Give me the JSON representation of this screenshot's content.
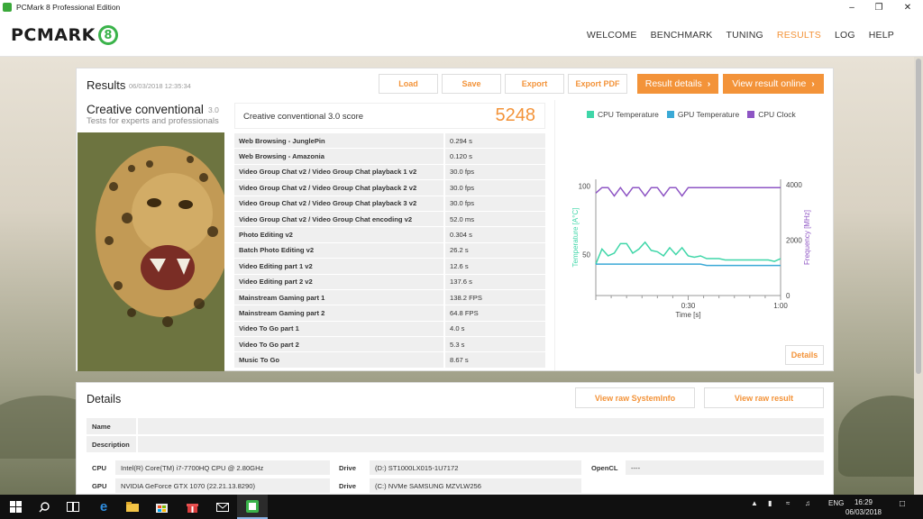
{
  "window": {
    "title": "PCMark 8 Professional Edition"
  },
  "header": {
    "logo_text": "PCMARK",
    "logo_mark": "8",
    "nav": [
      "WELCOME",
      "BENCHMARK",
      "TUNING",
      "RESULTS",
      "LOG",
      "HELP"
    ],
    "active_nav": "RESULTS"
  },
  "results": {
    "title": "Results",
    "date": "06/03/2018 12:35:34",
    "buttons": {
      "load": "Load",
      "save": "Save",
      "export": "Export",
      "export_pdf": "Export PDF",
      "result_details": "Result details",
      "view_online": "View result online"
    },
    "test_name": "Creative conventional",
    "test_version": "3.0",
    "test_subtitle": "Tests for experts and professionals",
    "score_label": "Creative conventional 3.0 score",
    "score_value": "5248",
    "rows": [
      {
        "name": "Web Browsing - JunglePin",
        "value": "0.294 s"
      },
      {
        "name": "Web Browsing - Amazonia",
        "value": "0.120 s"
      },
      {
        "name": "Video Group Chat v2 / Video Group Chat playback 1 v2",
        "value": "30.0 fps"
      },
      {
        "name": "Video Group Chat v2 / Video Group Chat playback 2 v2",
        "value": "30.0 fps"
      },
      {
        "name": "Video Group Chat v2 / Video Group Chat playback 3 v2",
        "value": "30.0 fps"
      },
      {
        "name": "Video Group Chat v2 / Video Group Chat encoding v2",
        "value": "52.0 ms"
      },
      {
        "name": "Photo Editing v2",
        "value": "0.304 s"
      },
      {
        "name": "Batch Photo Editing v2",
        "value": "26.2 s"
      },
      {
        "name": "Video Editing part 1 v2",
        "value": "12.6 s"
      },
      {
        "name": "Video Editing part 2 v2",
        "value": "137.6 s"
      },
      {
        "name": "Mainstream Gaming part 1",
        "value": "138.2 FPS"
      },
      {
        "name": "Mainstream Gaming part 2",
        "value": "64.8 FPS"
      },
      {
        "name": "Video To Go part 1",
        "value": "4.0 s"
      },
      {
        "name": "Video To Go part 2",
        "value": "5.3 s"
      },
      {
        "name": "Music To Go",
        "value": "8.67 s"
      }
    ],
    "details_button": "Details"
  },
  "chart_data": {
    "type": "line",
    "legend": [
      "CPU Temperature",
      "GPU Temperature",
      "CPU Clock"
    ],
    "colors": {
      "cpu_temp": "#3fd6a8",
      "gpu_temp": "#3aa9d6",
      "cpu_clock": "#8e55c4"
    },
    "x": [
      0,
      2,
      4,
      6,
      8,
      10,
      12,
      14,
      16,
      18,
      20,
      22,
      24,
      26,
      28,
      30,
      32,
      34,
      36,
      38,
      40,
      42,
      44,
      46,
      48,
      50,
      52,
      54,
      56,
      58,
      60
    ],
    "series": [
      {
        "name": "CPU Temperature",
        "axis": "left",
        "values": [
          43,
          54,
          49,
          51,
          58,
          58,
          51,
          54,
          59,
          53,
          52,
          49,
          55,
          50,
          55,
          49,
          48,
          49,
          47,
          47,
          47,
          46,
          46,
          46,
          46,
          46,
          46,
          46,
          46,
          45,
          47
        ]
      },
      {
        "name": "GPU Temperature",
        "axis": "left",
        "values": [
          43,
          43,
          43,
          43,
          43,
          43,
          43,
          43,
          43,
          43,
          43,
          43,
          43,
          43,
          43,
          43,
          43,
          43,
          42,
          42,
          42,
          42,
          42,
          42,
          42,
          42,
          42,
          42,
          42,
          42,
          42
        ]
      },
      {
        "name": "CPU Clock",
        "axis": "right",
        "values": [
          3700,
          3900,
          3900,
          3600,
          3900,
          3600,
          3900,
          3900,
          3600,
          3900,
          3900,
          3600,
          3900,
          3900,
          3600,
          3900,
          3900,
          3900,
          3900,
          3900,
          3900,
          3900,
          3900,
          3900,
          3900,
          3900,
          3900,
          3900,
          3900,
          3900,
          3900
        ]
      }
    ],
    "x_ticks": [
      "0:30",
      "1:00"
    ],
    "xlabel": "Time [s]",
    "y_left_ticks": [
      "100",
      "50"
    ],
    "y_left_label": "Temperature [A°C]",
    "y_right_ticks": [
      "4000",
      "2000",
      "0"
    ],
    "y_right_label": "Frequency [MHz]",
    "ylim_left": [
      20,
      105
    ],
    "ylim_right": [
      0,
      4200
    ],
    "xlim": [
      0,
      60
    ]
  },
  "details": {
    "title": "Details",
    "btn_sysinfo": "View raw SystemInfo",
    "btn_raw": "View raw result",
    "name_label": "Name",
    "description_label": "Description",
    "cpu_label": "CPU",
    "cpu_value": "Intel(R) Core(TM) i7-7700HQ CPU @ 2.80GHz",
    "gpu_label": "GPU",
    "gpu_value": "NVIDIA GeForce GTX 1070 (22.21.13.8290)",
    "drive_label": "Drive",
    "drive1_value": "(D:) ST1000LX015-1U7172",
    "drive2_value": "(C:) NVMe SAMSUNG MZVLW256",
    "opencl_label": "OpenCL",
    "opencl_value": "----"
  },
  "taskbar": {
    "lang": "ENG",
    "time": "16:29",
    "date": "06/03/2018"
  }
}
